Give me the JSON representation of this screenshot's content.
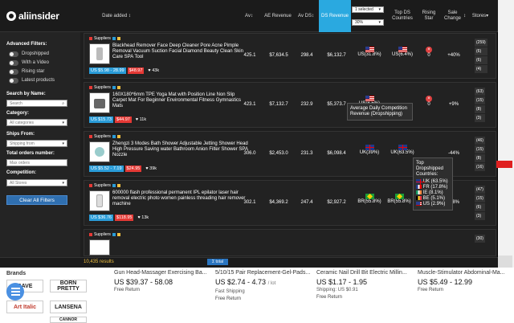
{
  "brand": {
    "name": "aliinsider"
  },
  "headers": {
    "date_added": "Date added",
    "avs": "Av",
    "ae_revenue": "AE Revenue",
    "avs_ds": "Av DS",
    "ds_revenue": "DS Revenue",
    "top_ds_countries": "Top DS Countries",
    "rising_star": "Rising Star",
    "sale_change": "Sale Change",
    "stores": "Stores",
    "selected_label": "1 selected",
    "pct_select": "30%"
  },
  "sidebar": {
    "advanced_filters": "Advanced Filters:",
    "toggles": [
      "Dropshipped",
      "With a Video",
      "Rising star",
      "Latest products"
    ],
    "search_by_name": "Search by Name:",
    "search_placeholder": "Search",
    "category": "Category:",
    "category_value": "All categories",
    "ships_from": "Ships From:",
    "ships_from_value": "Shipping from",
    "total_orders": "Total orders number:",
    "total_orders_placeholder": "Max orders",
    "competition": "Competition:",
    "competition_value": "All Stores",
    "clear_button": "Clear All Filters"
  },
  "rows": [
    {
      "title": "Blackhead Remover Face Deep Cleaner Pore Acne Pimple Removal Vacuum Suction Facial Diamond Beauty Clean Skin Care SPA Tool",
      "price": "US $5.98 - 28.99",
      "old_price": "$48.97",
      "likes": "43k",
      "avs": "425.1",
      "ae_revenue": "$7,634.5",
      "avs_ds": "298.4",
      "ds_revenue": "$6,132.7",
      "top_country": "US(31.8%)",
      "country2": "US(6.4%)",
      "rising": "0",
      "sale_change": "+40%",
      "stores": [
        "(259)",
        "(6)",
        "(6)",
        "(4)",
        "(6)"
      ]
    },
    {
      "title": "160X180*6mm TPE Yoga Mat with Position Line Non Slip Carpet Mat For Beginner Environmental Fitness Gymnastics Mats",
      "price": "US $15.73",
      "old_price": "$44.97",
      "likes": "11k",
      "avs": "423.1",
      "ae_revenue": "$7,132.7",
      "avs_ds": "232.9",
      "ds_revenue": "$5,373.7",
      "top_country": "US(8.5%)",
      "country2": "",
      "rising": "0",
      "sale_change": "+9%",
      "stores": [
        "(63)",
        "(15)",
        "(8)",
        "(3)",
        "(6)"
      ]
    },
    {
      "title": "Zhengzi 3 Modes Bath Shower Adjustable Jetting Shower Head High Pressure Saving water Bathroom Anion Filter Shower SPA Nozzle",
      "price": "US $5.52 - 7.19",
      "old_price": "$24.95",
      "likes": "39k",
      "avs": "306.0",
      "ae_revenue": "$2,453.0",
      "avs_ds": "231.3",
      "ds_revenue": "$6,098.4",
      "top_country": "UK(39%)",
      "country2": "UK(63.5%)",
      "rising": "0",
      "sale_change": "-44%",
      "stores": [
        "(46)",
        "(15)",
        "(8)",
        "(16)",
        "(4)"
      ]
    },
    {
      "title": "600000 flash professional permanent IPL epilator laser hair removal electric photo women painless threading hair remover machine",
      "price": "US $36.76",
      "old_price": "$118.95",
      "likes": "13k",
      "avs": "302.1",
      "ae_revenue": "$4,369.2",
      "avs_ds": "247.4",
      "ds_revenue": "$2,927.2",
      "top_country": "BR(55.8%)",
      "country2": "BR(55.8%)",
      "rising": "0",
      "sale_change": "-38%",
      "stores": [
        "(47)",
        "(15)",
        "(6)",
        "(3)",
        "(15)"
      ]
    },
    {
      "title": "",
      "price": "",
      "old_price": "",
      "likes": "",
      "avs": "",
      "ae_revenue": "",
      "avs_ds": "",
      "ds_revenue": "",
      "top_country": "",
      "country2": "",
      "rising": "",
      "sale_change": "",
      "stores": [
        "(30)"
      ]
    }
  ],
  "supplier_label": "Suppliers",
  "tooltip1": "Average Daily Competition Revenue (Dropshipping)",
  "tooltip2": {
    "title": "Top Dropshipped Countries:",
    "items": [
      "UK (63.5%)",
      "FR (17.8%)",
      "IE (8.1%)",
      "BE (5.1%)",
      "US (2.9%)"
    ]
  },
  "footer": {
    "results": "10,435 results",
    "total_btn": "Σ total"
  },
  "store": {
    "brands_title": "Brands",
    "brands": [
      "CAVE",
      "BORN PRETTY",
      "Art Italic",
      "LANSENA",
      "CANNOR"
    ],
    "products": [
      {
        "name": "Gun Head-Massager Exercising Ba...",
        "price": "US $39.37 - 58.08",
        "ship": "",
        "ret": "Free Return"
      },
      {
        "name": "5/10/15 Pair Replacement-Gel-Pads...",
        "price": "US $2.74 - 4.73",
        "unit": "/ lot",
        "ship": "Fast Shipping",
        "ret": "Free Return"
      },
      {
        "name": "Ceramic Nail Drill Bit Electric Millin...",
        "price": "US $1.17 - 1.95",
        "ship": "Shipping: US $0.91",
        "ret": "Free Return"
      },
      {
        "name": "Muscle-Stimulator Abdominal-Ma...",
        "price": "US $5.49 - 12.99",
        "ship": "",
        "ret": "Free Return"
      }
    ]
  }
}
